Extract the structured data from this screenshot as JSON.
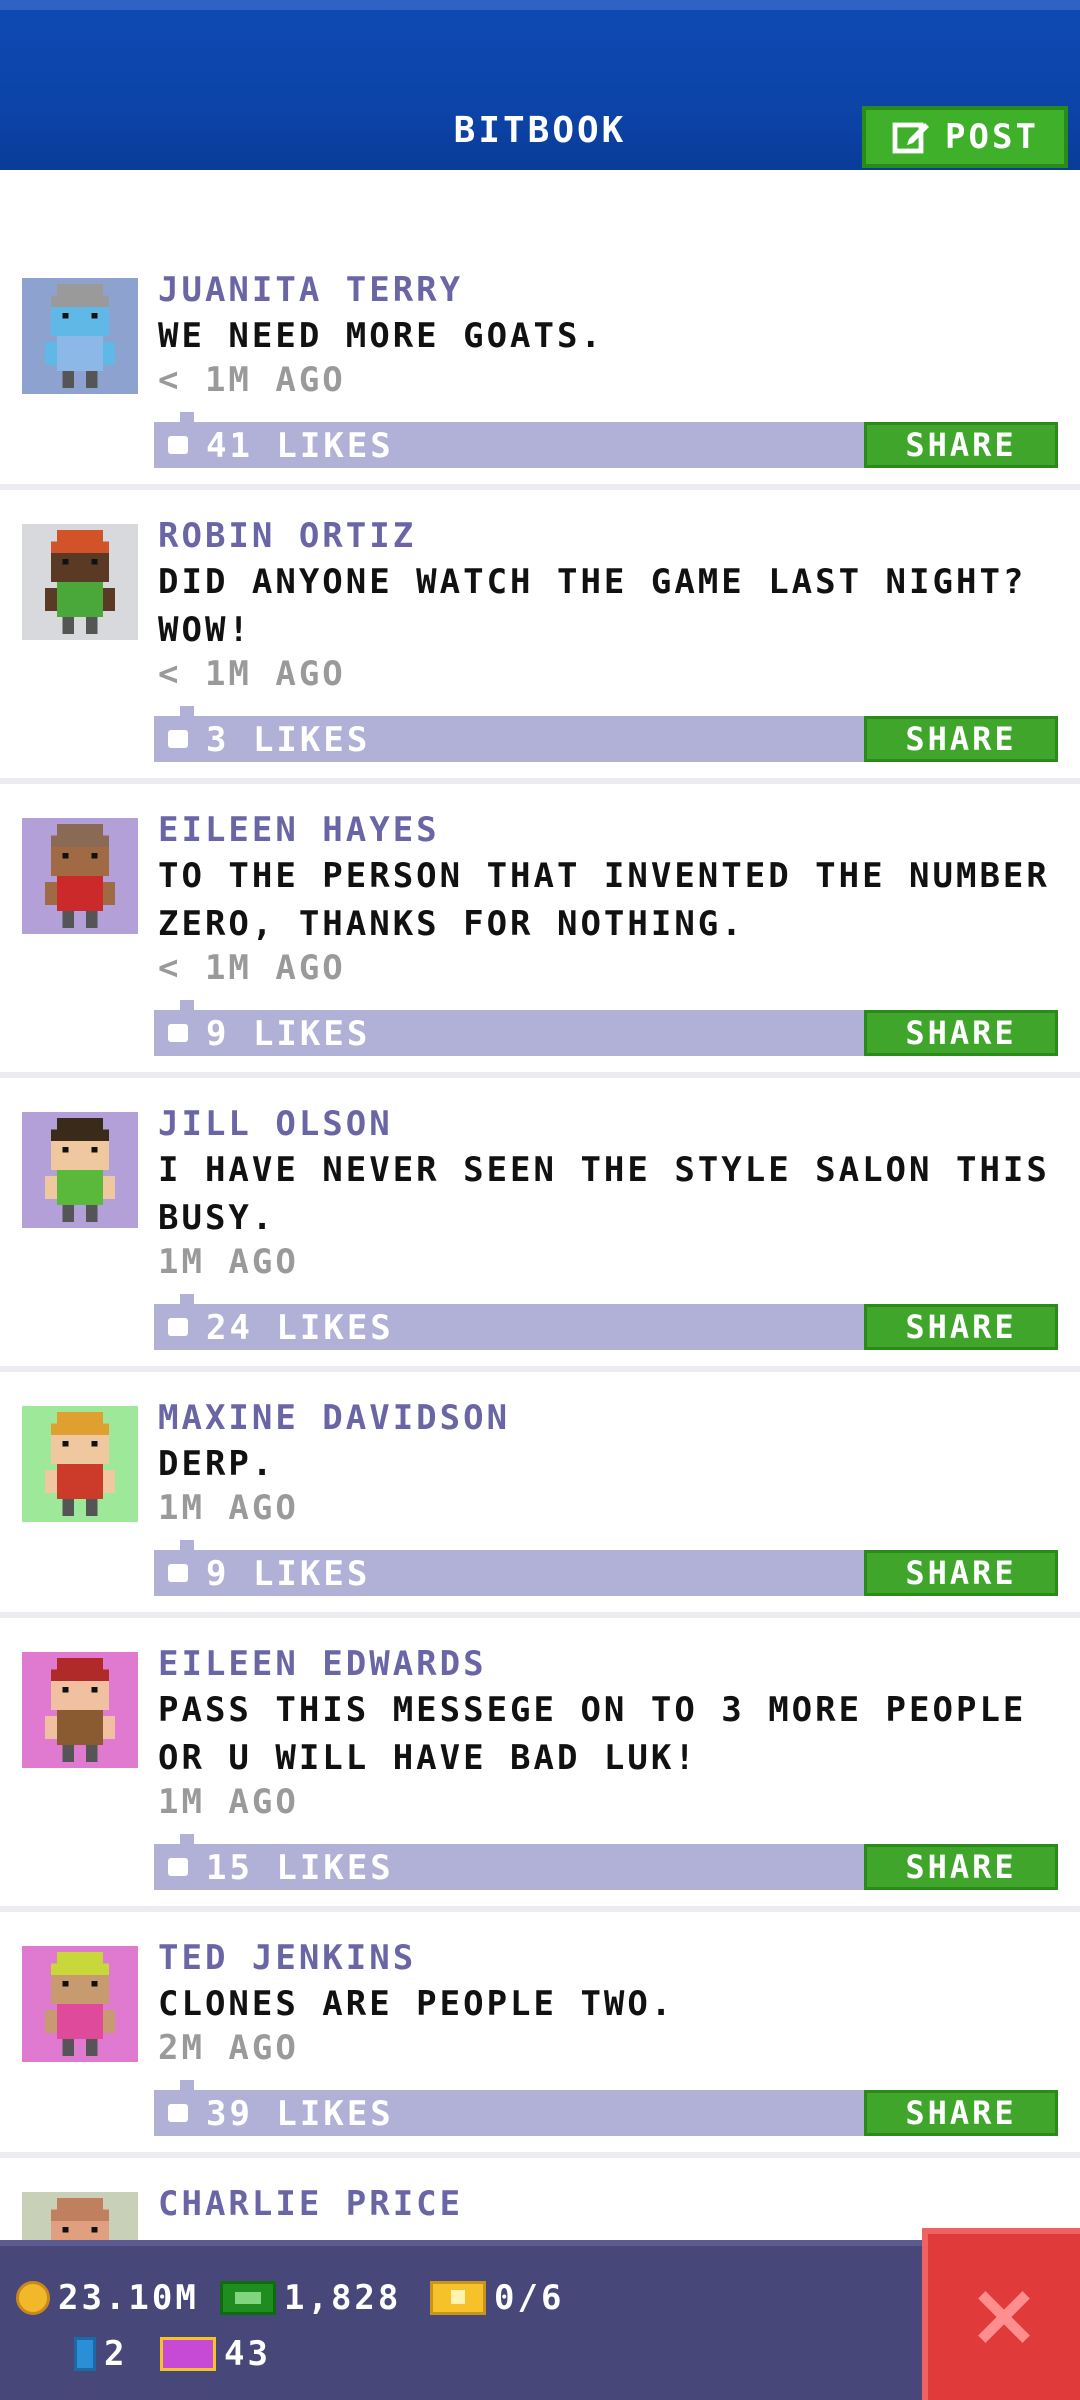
{
  "header": {
    "title": "BITBOOK",
    "post_label": "POST"
  },
  "posts": [
    {
      "name": "JUANITA TERRY",
      "text": "WE NEED MORE GOATS.",
      "time": "< 1M AGO",
      "likes": "41 LIKES",
      "share": "SHARE",
      "avatar_bg": "#8ea2cf",
      "skin": "#5fb8e6",
      "hair": "#9a9a9a",
      "shirt": "#8bb8e6"
    },
    {
      "name": "ROBIN ORTIZ",
      "text": "DID ANYONE WATCH THE GAME LAST NIGHT? WOW!",
      "time": "< 1M AGO",
      "likes": "3 LIKES",
      "share": "SHARE",
      "avatar_bg": "#d7d9dd",
      "skin": "#5a3a25",
      "hair": "#d2522a",
      "shirt": "#4aa83a"
    },
    {
      "name": "EILEEN HAYES",
      "text": "TO THE PERSON THAT INVENTED THE NUMBER ZERO, THANKS FOR NOTHING.",
      "time": "< 1M AGO",
      "likes": "9 LIKES",
      "share": "SHARE",
      "avatar_bg": "#b3a0d9",
      "skin": "#a06a45",
      "hair": "#8a6a55",
      "shirt": "#cc2a2a"
    },
    {
      "name": "JILL OLSON",
      "text": "I HAVE NEVER SEEN THE STYLE SALON THIS BUSY.",
      "time": "1M AGO",
      "likes": "24 LIKES",
      "share": "SHARE",
      "avatar_bg": "#b3a0d9",
      "skin": "#f0c8a0",
      "hair": "#3a2a1a",
      "shirt": "#5ab83a"
    },
    {
      "name": "MAXINE DAVIDSON",
      "text": "DERP.",
      "time": "1M AGO",
      "likes": "9 LIKES",
      "share": "SHARE",
      "avatar_bg": "#9ee89a",
      "skin": "#f0c8a0",
      "hair": "#e0a030",
      "shirt": "#cc3a2a"
    },
    {
      "name": "EILEEN EDWARDS",
      "text": "PASS THIS MESSEGE ON TO 3 MORE PEOPLE OR U WILL HAVE BAD LUK!",
      "time": "1M AGO",
      "likes": "15 LIKES",
      "share": "SHARE",
      "avatar_bg": "#e07ad0",
      "skin": "#f0c0a0",
      "hair": "#b02a2a",
      "shirt": "#8a5a30"
    },
    {
      "name": "TED JENKINS",
      "text": "CLONES ARE PEOPLE TWO.",
      "time": "2M AGO",
      "likes": "39 LIKES",
      "share": "SHARE",
      "avatar_bg": "#e07ad0",
      "skin": "#c89a70",
      "hair": "#c8d83a",
      "shirt": "#e04a9a"
    },
    {
      "name": "CHARLIE PRICE",
      "text": "",
      "time": "",
      "likes": "",
      "share": "",
      "avatar_bg": "#c8d0b8",
      "skin": "#e0a080",
      "hair": "#c08060",
      "shirt": "#8a8a8a"
    }
  ],
  "status_bar": {
    "coins": "23.10M",
    "bux": "1,828",
    "tickets": "0/6",
    "bitbooks": "2",
    "vip": "43"
  },
  "colors": {
    "header_bg": "#0c44a8",
    "name_color": "#6a66a6",
    "likes_bar": "#b1b0d6",
    "share_green": "#3fa52b",
    "bottom_bar": "#47477a",
    "close_red": "#e03a3a"
  }
}
